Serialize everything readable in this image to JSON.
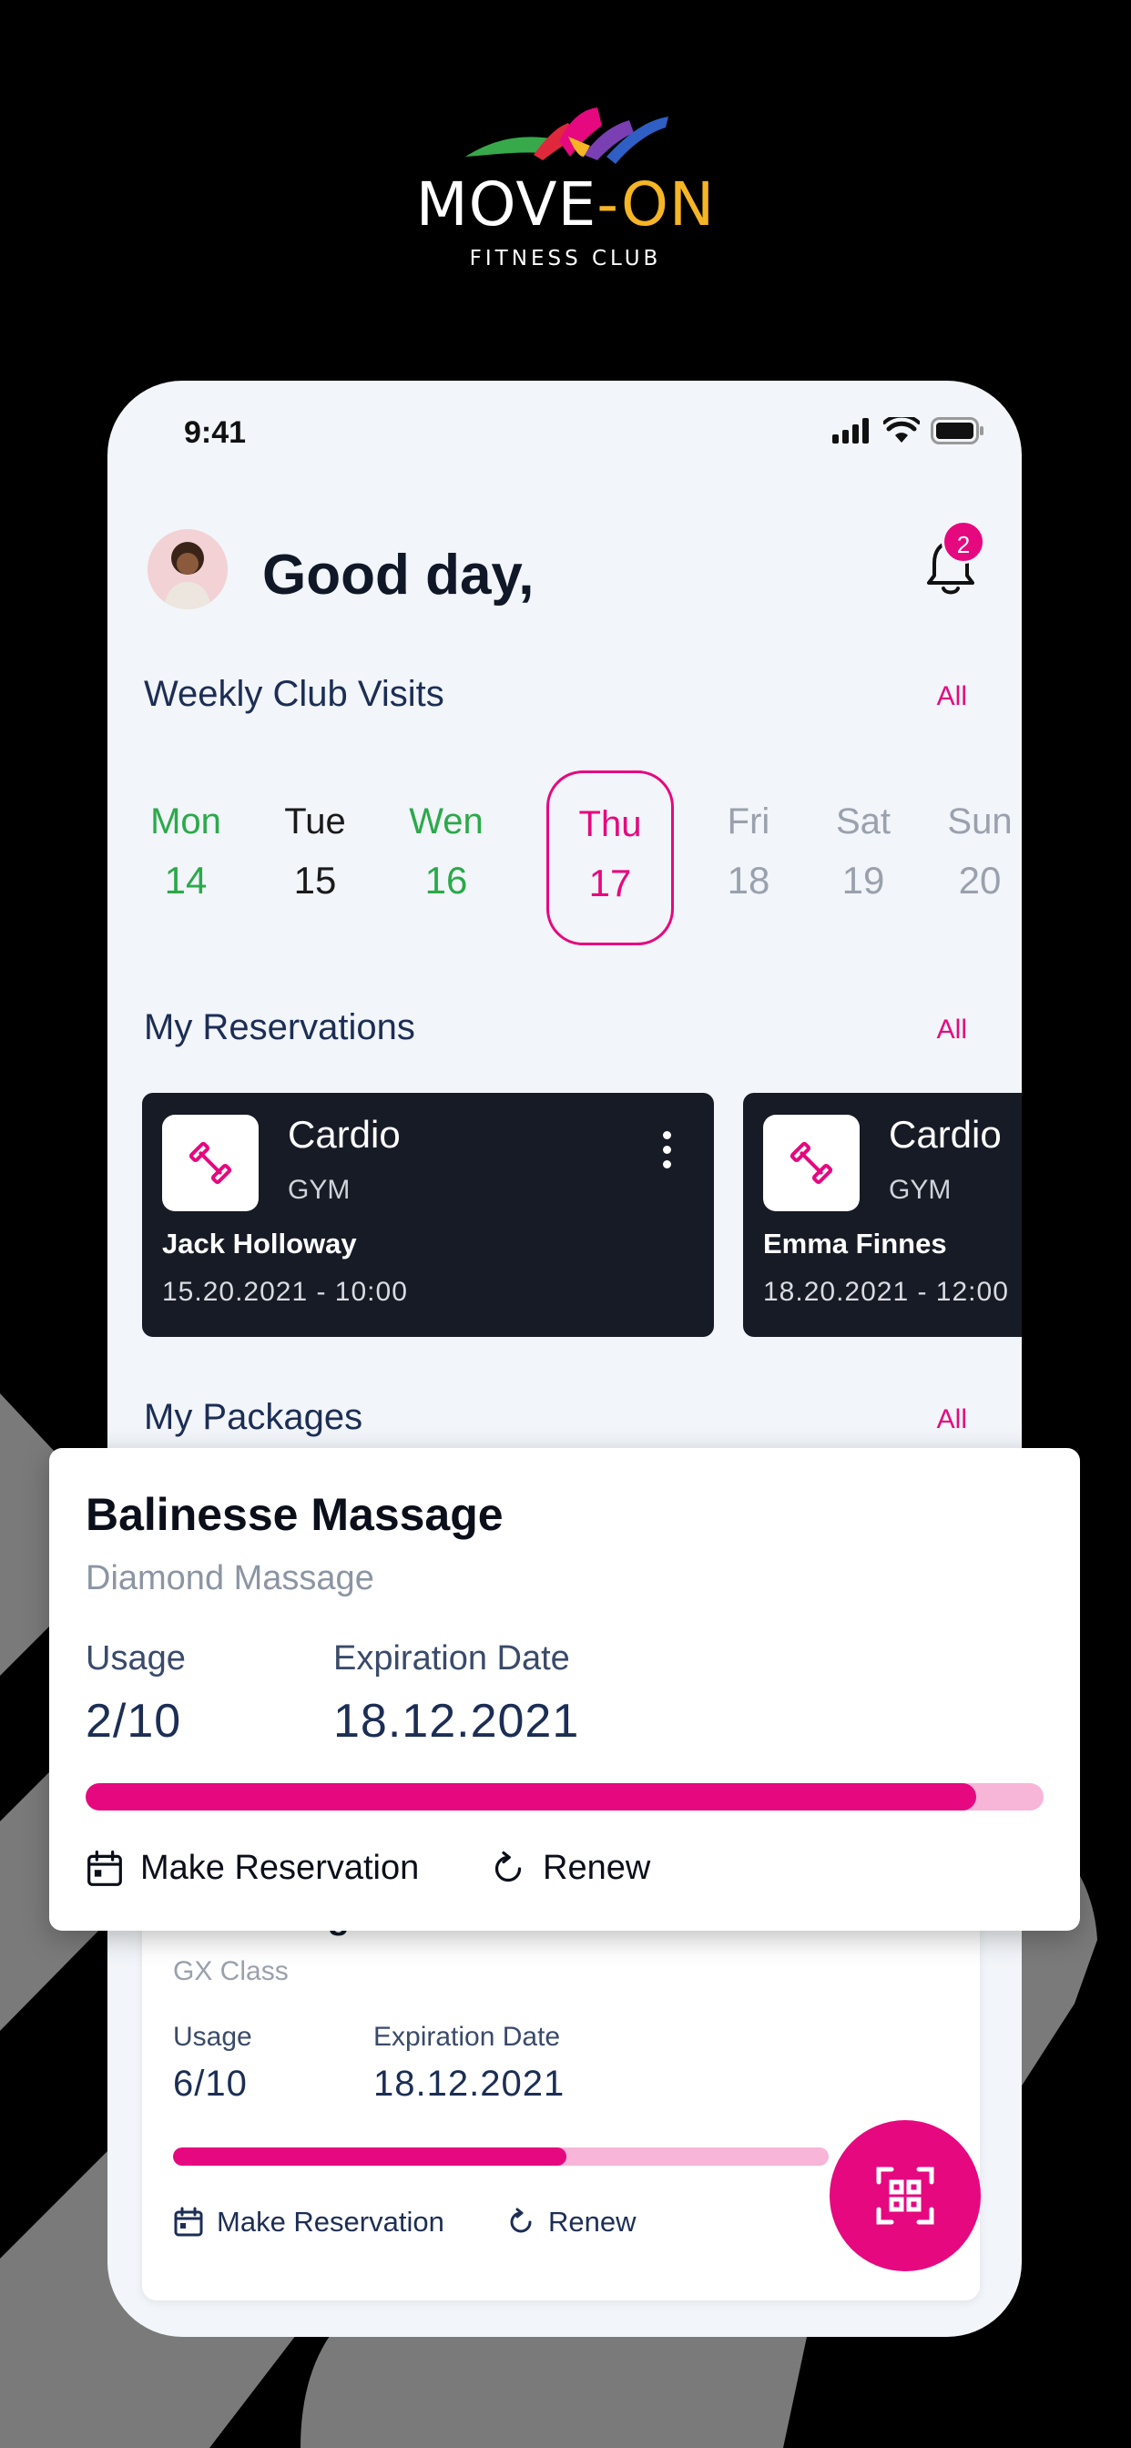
{
  "brand": {
    "name_left": "MOVE",
    "name_dash": "-",
    "name_right": "ON",
    "subtitle": "FITNESS CLUB"
  },
  "status_bar": {
    "time": "9:41"
  },
  "header": {
    "greeting": "Good day,",
    "notification_count": "2"
  },
  "weekly": {
    "title": "Weekly Club Visits",
    "all_label": "All",
    "days": [
      {
        "name": "Mon",
        "date": "14",
        "state": "visited"
      },
      {
        "name": "Tue",
        "date": "15",
        "state": "normal"
      },
      {
        "name": "Wen",
        "date": "16",
        "state": "visited"
      },
      {
        "name": "Thu",
        "date": "17",
        "state": "selected"
      },
      {
        "name": "Fri",
        "date": "18",
        "state": "future"
      },
      {
        "name": "Sat",
        "date": "19",
        "state": "future"
      },
      {
        "name": "Sun",
        "date": "20",
        "state": "future"
      }
    ]
  },
  "reservations": {
    "title": "My Reservations",
    "all_label": "All",
    "items": [
      {
        "title": "Cardio",
        "subtitle": "GYM",
        "trainer": "Jack Holloway",
        "datetime": "15.20.2021  -  10:00"
      },
      {
        "title": "Cardio",
        "subtitle": "GYM",
        "trainer": "Emma Finnes",
        "datetime": "18.20.2021  -  12:00"
      }
    ]
  },
  "packages": {
    "title": "My Packages",
    "all_label": "All",
    "items": [
      {
        "title": "Balinesse Massage",
        "subtitle": "Diamond Massage",
        "usage_label": "Usage",
        "usage_value": "2/10",
        "expiry_label": "Expiration Date",
        "expiry_value": "18.12.2021",
        "progress": 0.93,
        "reserve_label": "Make Reservation",
        "renew_label": "Renew"
      },
      {
        "title": "Hatha Yoga",
        "subtitle": "GX Class",
        "usage_label": "Usage",
        "usage_value": "6/10",
        "expiry_label": "Expiration Date",
        "expiry_value": "18.12.2021",
        "progress": 0.6,
        "reserve_label": "Make Reservation",
        "renew_label": "Renew"
      }
    ]
  },
  "colors": {
    "accent": "#e6087f",
    "visited": "#2ba94a",
    "card_dark": "#171b26",
    "navy": "#1c2e55"
  },
  "icons": [
    "bell-icon",
    "dumbbell-icon",
    "more-vertical-icon",
    "calendar-icon",
    "refresh-icon",
    "qr-scan-icon",
    "signal-icon",
    "wifi-icon",
    "battery-icon"
  ]
}
